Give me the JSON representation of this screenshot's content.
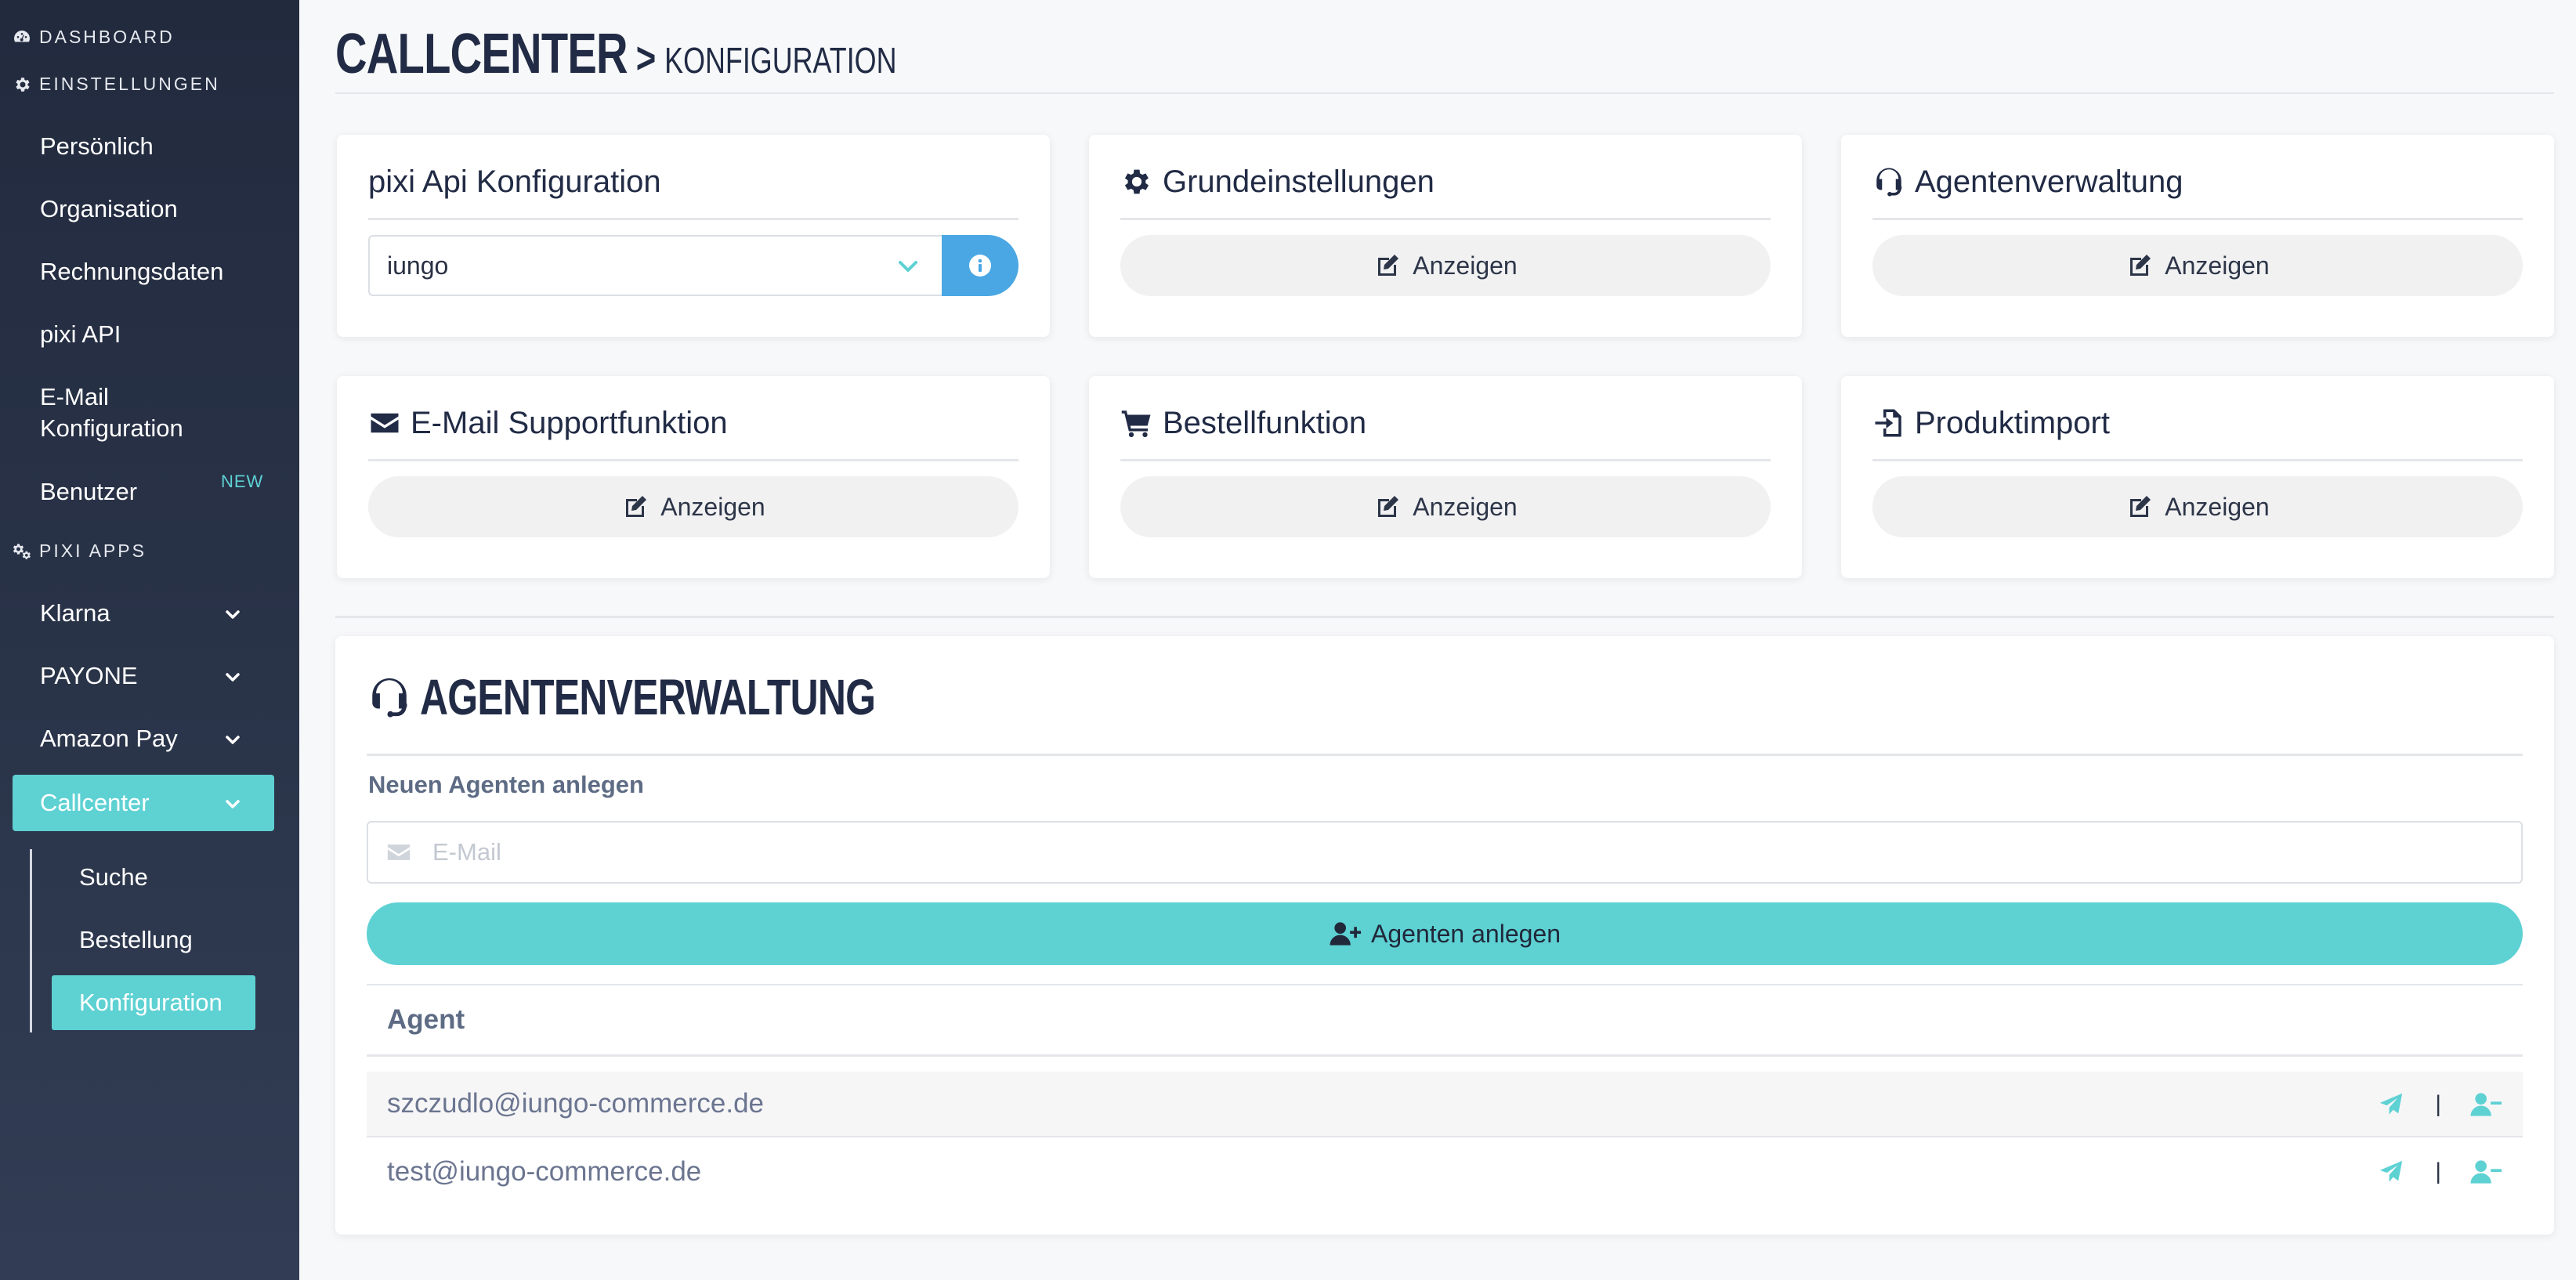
{
  "sidebar": {
    "sections": {
      "dashboard": "DASHBOARD",
      "settings": "EINSTELLUNGEN",
      "apps": "PIXI APPS"
    },
    "settings_items": [
      {
        "label": "Persönlich"
      },
      {
        "label": "Organisation"
      },
      {
        "label": "Rechnungsdaten"
      },
      {
        "label": "pixi API"
      },
      {
        "label": "E-Mail Konfiguration"
      },
      {
        "label": "Benutzer",
        "badge": "NEW"
      }
    ],
    "app_items": [
      {
        "label": "Klarna"
      },
      {
        "label": "PAYONE"
      },
      {
        "label": "Amazon Pay"
      },
      {
        "label": "Callcenter",
        "active": true
      }
    ],
    "callcenter_sub": [
      {
        "label": "Suche"
      },
      {
        "label": "Bestellung"
      },
      {
        "label": "Konfiguration",
        "active": true
      }
    ]
  },
  "page": {
    "title": "CALLCENTER",
    "separator": ">",
    "subtitle": "KONFIGURATION"
  },
  "cards": {
    "api": {
      "title": "pixi Api Konfiguration",
      "selected": "iungo"
    },
    "basic": {
      "title": "Grundeinstellungen",
      "button": "Anzeigen"
    },
    "agents": {
      "title": "Agentenverwaltung",
      "button": "Anzeigen"
    },
    "email": {
      "title": "E-Mail Supportfunktion",
      "button": "Anzeigen"
    },
    "order": {
      "title": "Bestellfunktion",
      "button": "Anzeigen"
    },
    "import": {
      "title": "Produktimport",
      "button": "Anzeigen"
    }
  },
  "agent_panel": {
    "title": "AGENTENVERWALTUNG",
    "new_label": "Neuen Agenten anlegen",
    "email_placeholder": "E-Mail",
    "email_value": "",
    "add_button": "Agenten anlegen",
    "column_header": "Agent",
    "agents": [
      {
        "email": "szczudlo@iungo-commerce.de"
      },
      {
        "email": "test@iungo-commerce.de"
      }
    ],
    "action_separator": "|"
  },
  "colors": {
    "accent": "#5ed1d3",
    "info": "#4aa7e3",
    "sidebar": "#262f44",
    "text": "#212b45"
  }
}
